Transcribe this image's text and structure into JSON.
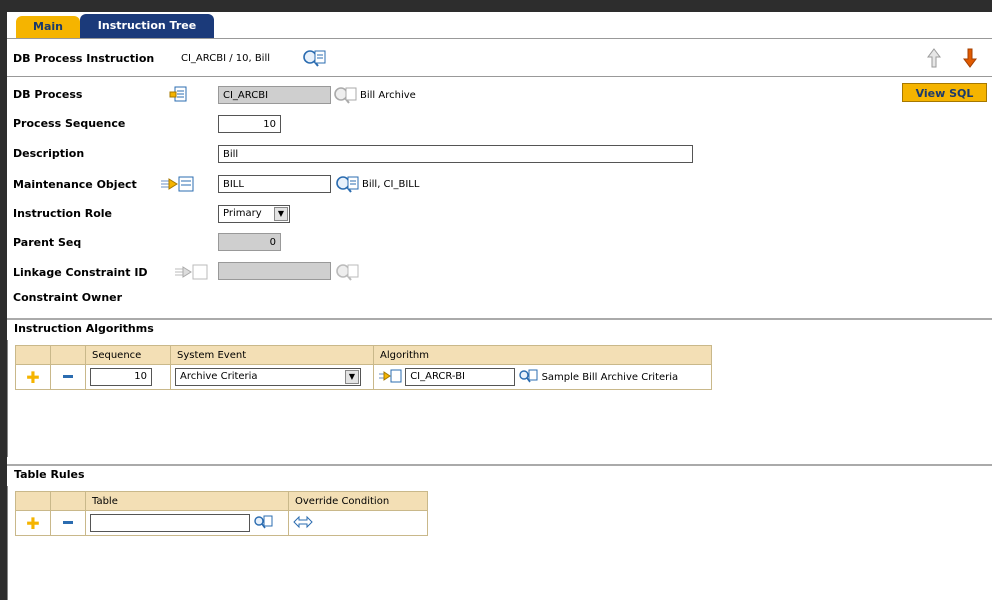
{
  "tabs": [
    {
      "label": "Main"
    },
    {
      "label": "Instruction Tree"
    }
  ],
  "header": {
    "label": "DB Process Instruction",
    "value": "CI_ARCBI / 10, Bill"
  },
  "buttons": {
    "view_sql": "View SQL"
  },
  "form": {
    "db_process": {
      "label": "DB Process",
      "value": "CI_ARCBI",
      "description": "Bill Archive"
    },
    "process_sequence": {
      "label": "Process Sequence",
      "value": "10"
    },
    "description": {
      "label": "Description",
      "value": "Bill"
    },
    "maintenance_object": {
      "label": "Maintenance Object",
      "value": "BILL",
      "description": "Bill, CI_BILL"
    },
    "instruction_role": {
      "label": "Instruction Role",
      "value": "Primary"
    },
    "parent_seq": {
      "label": "Parent Seq",
      "value": "0"
    },
    "linkage_constraint_id": {
      "label": "Linkage Constraint ID",
      "value": ""
    },
    "constraint_owner": {
      "label": "Constraint Owner"
    }
  },
  "instruction_algorithms": {
    "title": "Instruction Algorithms",
    "columns": [
      "Sequence",
      "System Event",
      "Algorithm"
    ],
    "rows": [
      {
        "sequence": "10",
        "system_event": "Archive Criteria",
        "algorithm": "CI_ARCR-BI",
        "algorithm_desc": "Sample Bill Archive Criteria"
      }
    ]
  },
  "table_rules": {
    "title": "Table Rules",
    "columns": [
      "Table",
      "Override Condition"
    ],
    "rows": [
      {
        "table": "",
        "override_condition": ""
      }
    ]
  },
  "colors": {
    "tab_active": "#f5b400",
    "tab_inactive": "#1b3a7a",
    "grid_header": "#f3dfb5",
    "readonly_field": "#cfcfcf",
    "add_icon": "#f5b400",
    "down_arrow": "#e05a00"
  },
  "icons": [
    "search-icon",
    "context-menu-icon",
    "add-row-icon",
    "delete-row-icon",
    "up-arrow-icon",
    "down-arrow-icon",
    "dropdown-icon",
    "override-condition-icon"
  ]
}
